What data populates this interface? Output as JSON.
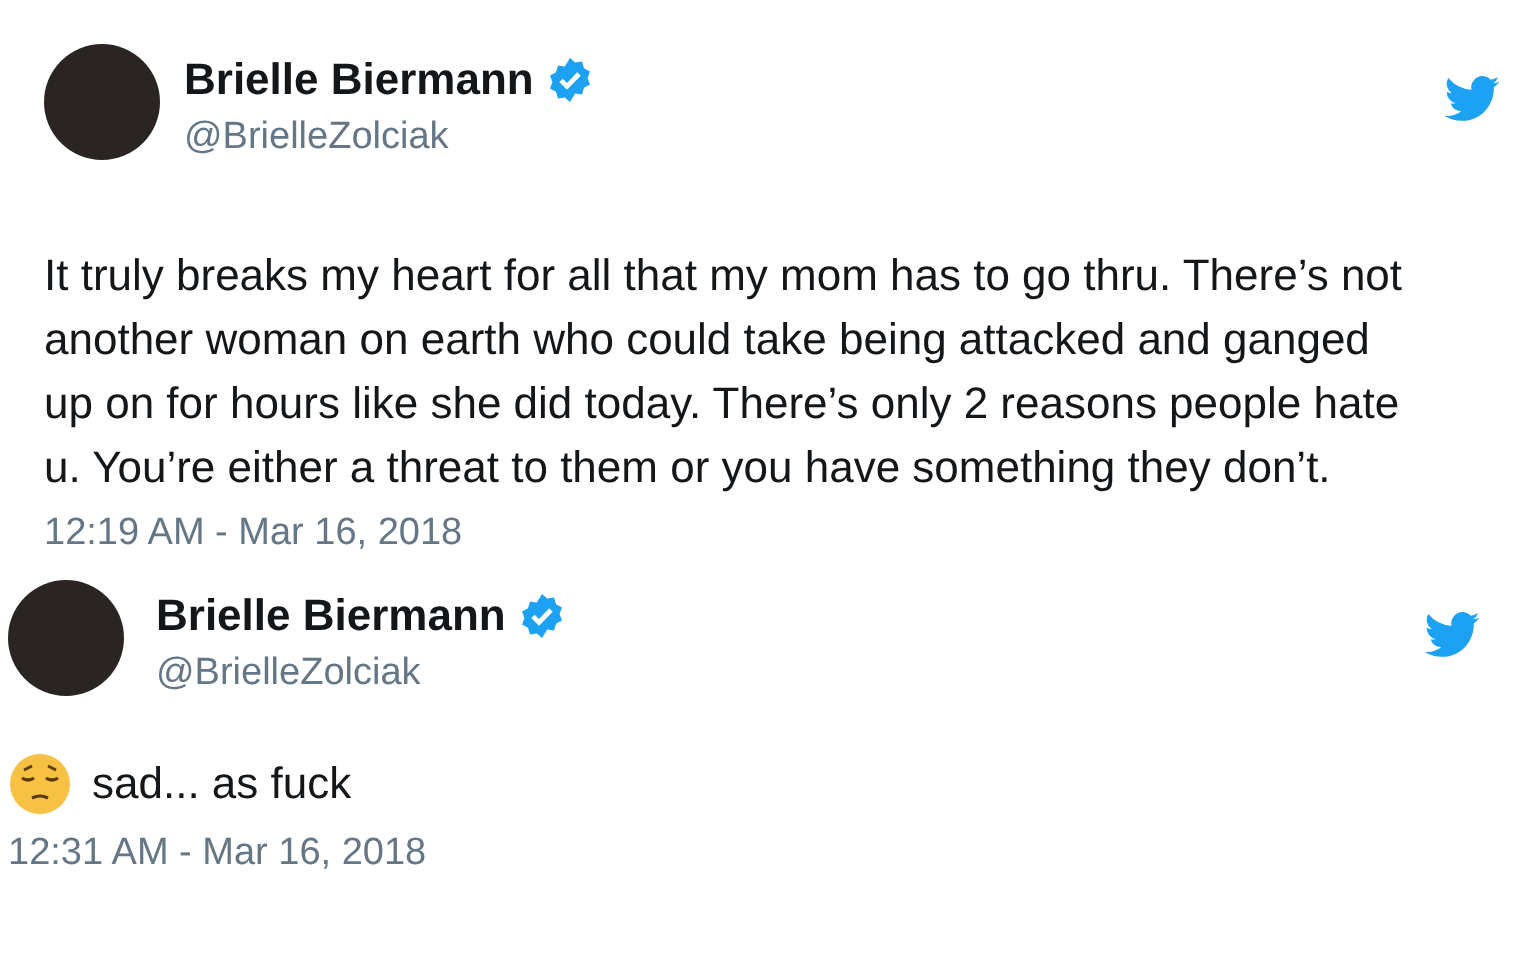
{
  "tweets": [
    {
      "name": "Brielle Biermann",
      "verified": true,
      "handle": "@BrielleZolciak",
      "text": "It truly breaks my heart for all that my mom has to go thru. There’s not another woman on earth who could take being attacked and ganged up on for hours like she did today. There’s only 2 reasons people hate u. You’re either a threat to them or you have something they don’t.",
      "emoji": false,
      "time": "12:19 AM - Mar 16, 2018"
    },
    {
      "name": "Brielle Biermann",
      "verified": true,
      "handle": "@BrielleZolciak",
      "text": "sad... as fuck",
      "emoji": true,
      "time": "12:31 AM - Mar 16, 2018"
    }
  ]
}
